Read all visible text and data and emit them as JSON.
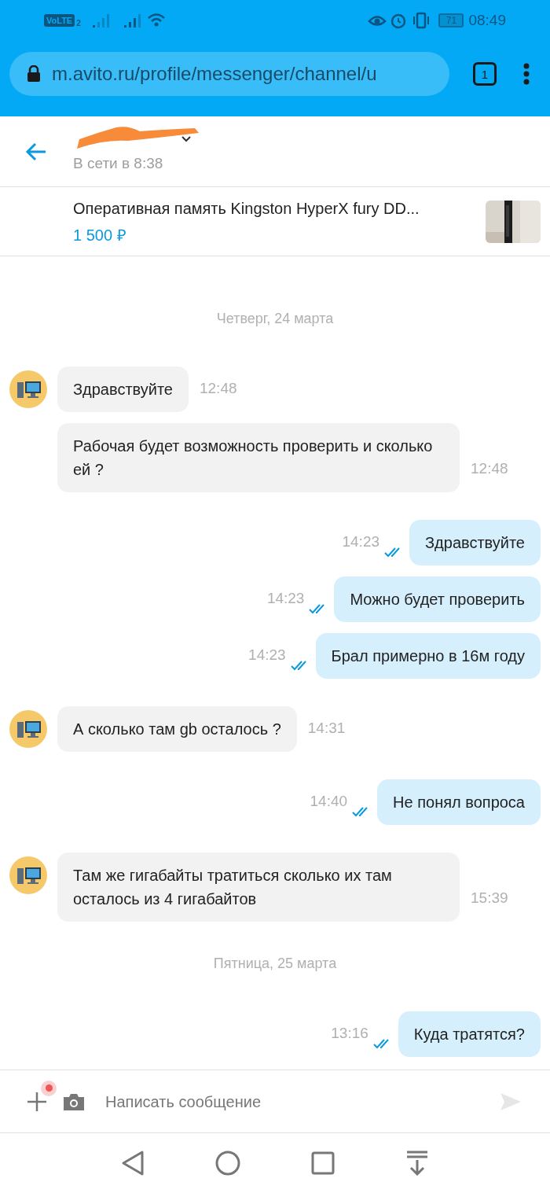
{
  "status_bar": {
    "network": "VoLTE",
    "sim": "2",
    "battery": "71",
    "time": "08:49"
  },
  "browser": {
    "url": "m.avito.ru/profile/messenger/channel/u",
    "tabs": "1"
  },
  "header": {
    "status": "В сети в 8:38"
  },
  "listing": {
    "title": "Оперативная память Kingston HyperX fury DD...",
    "price": "1 500 ₽"
  },
  "messages": [
    {
      "kind": "date",
      "text": "Четверг, 24 марта"
    },
    {
      "kind": "incoming",
      "text": "Здравствуйте",
      "time": "12:48"
    },
    {
      "kind": "incoming",
      "text": "Рабочая будет возможность проверить и сколько ей ?",
      "time": "12:48"
    },
    {
      "kind": "outgoing",
      "text": "Здравствуйте",
      "time": "14:23",
      "read": true
    },
    {
      "kind": "outgoing",
      "text": "Можно будет проверить",
      "time": "14:23",
      "read": true
    },
    {
      "kind": "outgoing",
      "text": "Брал примерно в 16м году",
      "time": "14:23",
      "read": true
    },
    {
      "kind": "incoming",
      "text": "А сколько там gb осталось ?",
      "time": "14:31"
    },
    {
      "kind": "outgoing",
      "text": "Не понял вопроса",
      "time": "14:40",
      "read": true
    },
    {
      "kind": "incoming",
      "text": "Там же гигабайты тратиться сколько их там осталось из 4 гигабайтов",
      "time": "15:39"
    },
    {
      "kind": "date",
      "text": "Пятница, 25 марта"
    },
    {
      "kind": "outgoing",
      "text": "Куда тратятся?",
      "time": "13:16",
      "read": true
    }
  ],
  "composer": {
    "placeholder": "Написать сообщение",
    "attach_badge": true
  }
}
